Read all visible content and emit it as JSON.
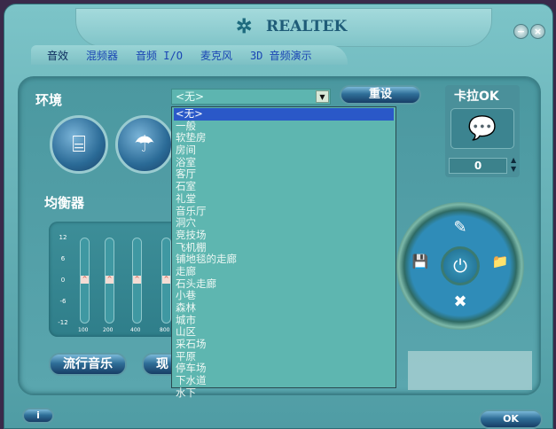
{
  "window": {
    "brand": "REALTEK",
    "minimize": "−",
    "close": "×"
  },
  "tabs": [
    "音效",
    "混频器",
    "音频 I/O",
    "麦克风",
    "3D 音频演示"
  ],
  "environment": {
    "label": "环境",
    "selected": "<无>",
    "arrow": "▼",
    "reset": "重设",
    "options": [
      "<无>",
      "一般",
      "软垫房",
      "房间",
      "浴室",
      "客厅",
      "石室",
      "礼堂",
      "音乐厅",
      "洞穴",
      "竞技场",
      "飞机棚",
      "铺地毯的走廊",
      "走廊",
      "石头走廊",
      "小巷",
      "森林",
      "城市",
      "山区",
      "采石场",
      "平原",
      "停车场",
      "下水道",
      "水下"
    ]
  },
  "karaoke": {
    "label": "卡拉OK",
    "value": "0",
    "up": "▲",
    "down": "▼"
  },
  "equalizer": {
    "label": "均衡器",
    "db_ticks": [
      "12",
      "6",
      "0",
      "-6",
      "-12"
    ],
    "bands": [
      "100",
      "200",
      "400",
      "800"
    ],
    "preset": "流行音乐",
    "preset2": "现"
  },
  "wheel": {
    "eraser": "✎",
    "save": "💾",
    "power": "⏻",
    "folder": "📁",
    "delete": "✖"
  },
  "footer": {
    "ok": "OK",
    "info": "i"
  }
}
